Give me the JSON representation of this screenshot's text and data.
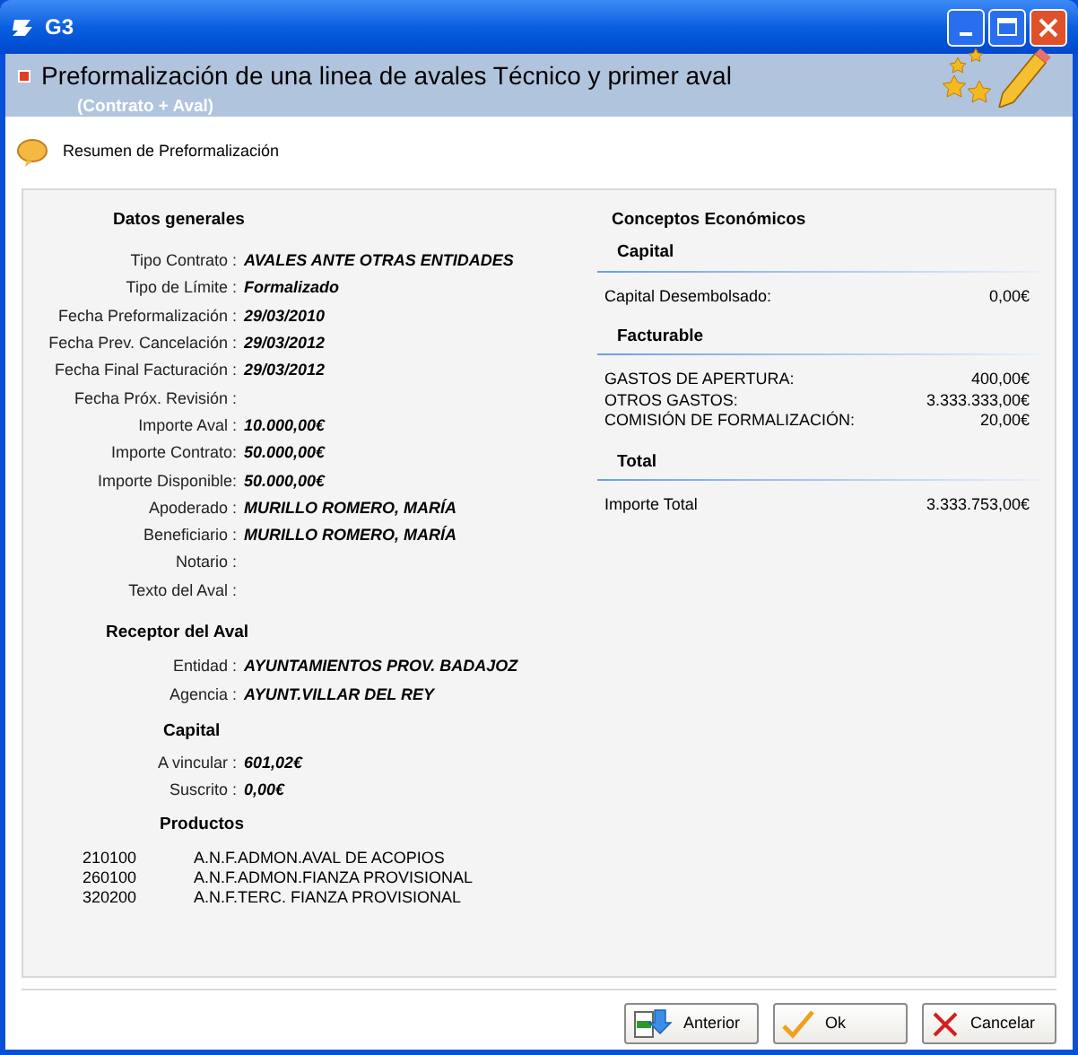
{
  "window": {
    "title": "G3"
  },
  "header": {
    "title": "Preformalización de una linea de avales Técnico y primer aval",
    "subtitle": "(Contrato + Aval)"
  },
  "summary_label": "Resumen de Preformalización",
  "datos_generales": {
    "heading": "Datos generales",
    "fields": [
      {
        "label": "Tipo Contrato :",
        "value": "AVALES ANTE OTRAS ENTIDADES"
      },
      {
        "label": "Tipo de Límite :",
        "value": "Formalizado"
      },
      {
        "label": "Fecha Preformalización :",
        "value": "29/03/2010"
      },
      {
        "label": "Fecha Prev. Cancelación :",
        "value": "29/03/2012"
      },
      {
        "label": "Fecha Final Facturación :",
        "value": "29/03/2012"
      },
      {
        "label": "Fecha Próx. Revisión :"
      },
      {
        "label": "Importe Aval :",
        "value": "10.000,00€"
      },
      {
        "label": "Importe Contrato:",
        "value": "50.000,00€"
      },
      {
        "label": "Importe Disponible:",
        "value": "50.000,00€"
      },
      {
        "label": "Apoderado :",
        "value": "MURILLO ROMERO, MARÍA"
      },
      {
        "label": "Beneficiario :",
        "value": "MURILLO ROMERO, MARÍA"
      },
      {
        "label": "Notario :"
      },
      {
        "label": "Texto del Aval :"
      }
    ]
  },
  "receptor": {
    "heading": "Receptor del Aval",
    "fields": [
      {
        "label": "Entidad :",
        "value": "AYUNTAMIENTOS PROV. BADAJOZ"
      },
      {
        "label": "Agencia :",
        "value": "AYUNT.VILLAR DEL REY"
      }
    ]
  },
  "capital": {
    "heading": "Capital",
    "fields": [
      {
        "label": "A vincular :",
        "value": "601,02€"
      },
      {
        "label": "Suscrito :",
        "value": "0,00€"
      }
    ]
  },
  "productos": {
    "heading": "Productos",
    "rows": [
      {
        "code": "210100",
        "name": "A.N.F.ADMON.AVAL DE ACOPIOS"
      },
      {
        "code": "260100",
        "name": "A.N.F.ADMON.FIANZA PROVISIONAL"
      },
      {
        "code": "320200",
        "name": "A.N.F.TERC. FIANZA PROVISIONAL"
      }
    ]
  },
  "conceptos": {
    "heading": "Conceptos Económicos",
    "groups": [
      {
        "heading": "Capital",
        "rows": [
          {
            "label": "Capital Desembolsado:",
            "value": "0,00€"
          }
        ]
      },
      {
        "heading": "Facturable",
        "rows": [
          {
            "label": "GASTOS DE APERTURA:",
            "value": "400,00€"
          },
          {
            "label": "OTROS GASTOS:",
            "value": "3.333.333,00€"
          },
          {
            "label": "COMISIÓN DE FORMALIZACIÓN:",
            "value": "20,00€"
          }
        ]
      },
      {
        "heading": "Total",
        "rows": [
          {
            "label": "Importe Total",
            "value": "3.333.753,00€"
          }
        ]
      }
    ]
  },
  "buttons": [
    {
      "label": "Anterior",
      "kind": "back"
    },
    {
      "label": "Ok",
      "kind": "ok"
    },
    {
      "label": "Cancelar",
      "kind": "cancel"
    }
  ]
}
